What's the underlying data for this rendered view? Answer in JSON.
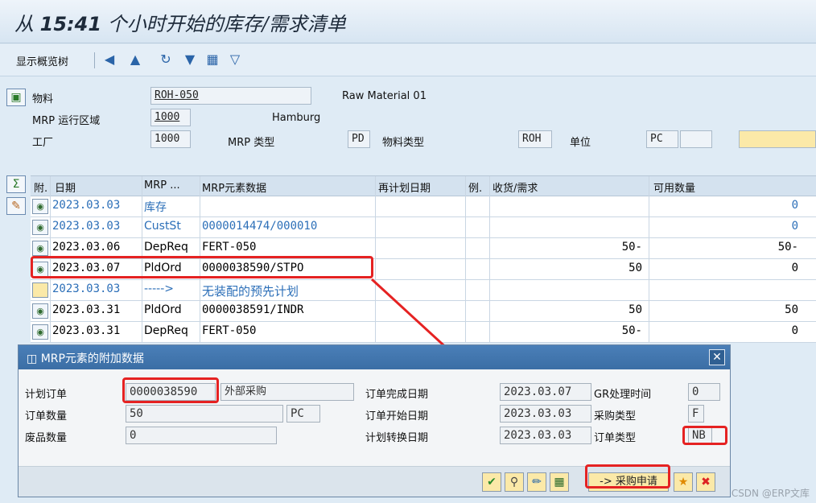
{
  "title": {
    "prefix": "从 ",
    "time": "15:41",
    "suffix": " 个小时开始的库存/需求清单"
  },
  "toolbar": {
    "overview_tree": "显示概览树"
  },
  "header": {
    "material_label": "物料",
    "material_value": "ROH-050",
    "material_desc": "Raw Material 01",
    "mrp_area_label": "MRP 运行区域",
    "mrp_area_value": "1000",
    "mrp_area_desc": "Hamburg",
    "plant_label": "工厂",
    "plant_value": "1000",
    "mrp_type_label": "MRP 类型",
    "mrp_type_value": "PD",
    "material_type_label": "物料类型",
    "material_type_value": "ROH",
    "unit_label": "单位",
    "unit_value": "PC"
  },
  "table": {
    "columns": {
      "att": "附.",
      "date": "日期",
      "mrp": "MRP ...",
      "element": "MRP元素数据",
      "resched": "再计划日期",
      "exc": "例.",
      "receipt": "收货/需求",
      "available": "可用数量"
    },
    "rows": [
      {
        "date": "2023.03.03",
        "mrp": "库存",
        "element": "",
        "receipt": "",
        "available": "0",
        "blue": true
      },
      {
        "date": "2023.03.03",
        "mrp": "CustSt",
        "element": "0000014474/000010",
        "receipt": "",
        "available": "0",
        "blue": true
      },
      {
        "date": "2023.03.06",
        "mrp": "DepReq",
        "element": "FERT-050",
        "receipt": "50-",
        "available": "50-",
        "blue": false
      },
      {
        "date": "2023.03.07",
        "mrp": "PldOrd",
        "element": "0000038590/STPO",
        "receipt": "50",
        "available": "0",
        "blue": false
      },
      {
        "date": "2023.03.03",
        "mrp": "----->",
        "element": "无装配的预先计划",
        "receipt": "",
        "available": "",
        "blue": true
      },
      {
        "date": "2023.03.31",
        "mrp": "PldOrd",
        "element": "0000038591/INDR",
        "receipt": "50",
        "available": "50",
        "blue": false
      },
      {
        "date": "2023.03.31",
        "mrp": "DepReq",
        "element": "FERT-050",
        "receipt": "50-",
        "available": "0",
        "blue": false
      }
    ]
  },
  "dialog": {
    "title": "MRP元素的附加数据",
    "planned_order_label": "计划订单",
    "planned_order_value": "0000038590",
    "procurement_text": "外部采购",
    "order_qty_label": "订单数量",
    "order_qty_value": "50",
    "order_qty_unit": "PC",
    "scrap_qty_label": "废品数量",
    "scrap_qty_value": "0",
    "finish_date_label": "订单完成日期",
    "finish_date_value": "2023.03.07",
    "gr_time_label": "GR处理时间",
    "gr_time_value": "0",
    "start_date_label": "订单开始日期",
    "start_date_value": "2023.03.03",
    "proc_type_label": "采购类型",
    "proc_type_value": "F",
    "conv_date_label": "计划转换日期",
    "conv_date_value": "2023.03.03",
    "order_type_label": "订单类型",
    "order_type_value": "NB",
    "purchase_req_button": "-> 采购申请"
  },
  "watermark": "CSDN @ERP文库"
}
